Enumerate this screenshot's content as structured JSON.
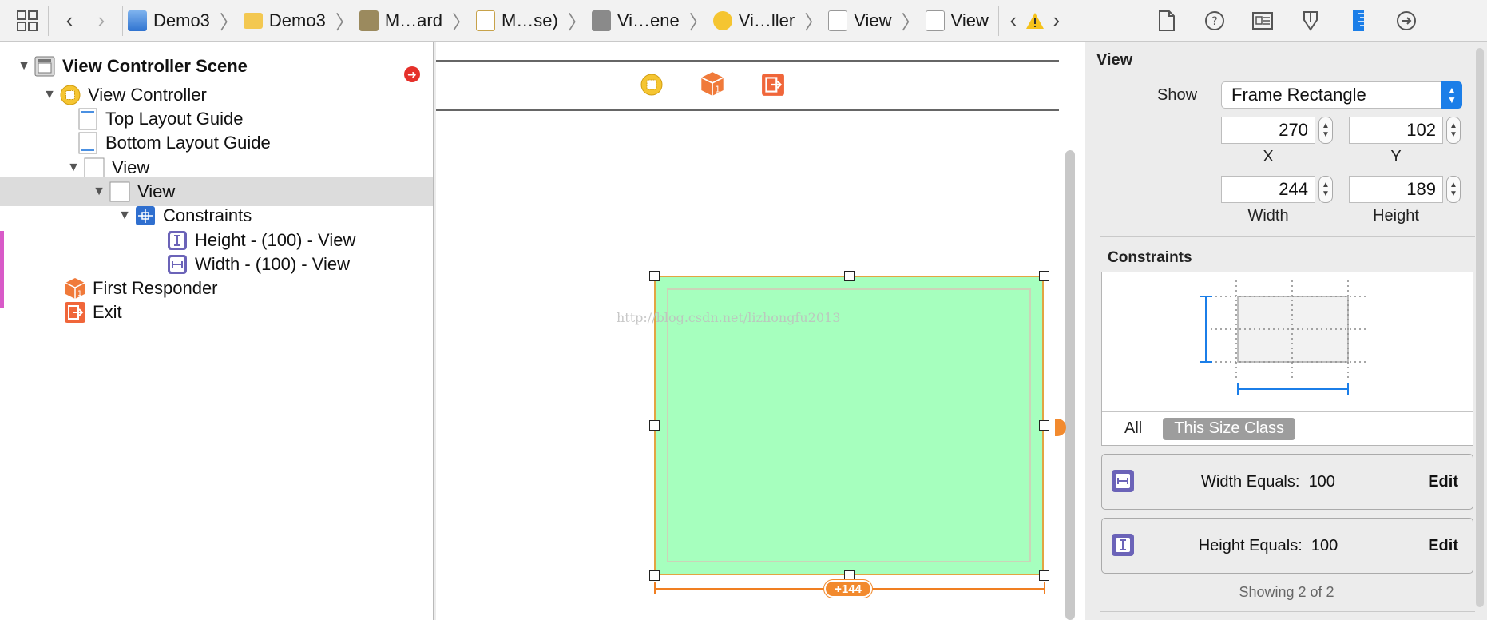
{
  "jumpbar": {
    "crumbs": [
      "Demo3",
      "Demo3",
      "M…ard",
      "M…se)",
      "Vi…ene",
      "Vi…ller",
      "View",
      "View"
    ]
  },
  "navigator": {
    "scene_title": "View Controller Scene",
    "items": [
      {
        "label": "View Controller"
      },
      {
        "label": "Top Layout Guide"
      },
      {
        "label": "Bottom Layout Guide"
      },
      {
        "label": "View"
      },
      {
        "label": "View"
      },
      {
        "label": "Constraints"
      },
      {
        "label": "Height - (100) - View"
      },
      {
        "label": "Width - (100) - View"
      },
      {
        "label": "First Responder"
      },
      {
        "label": "Exit"
      }
    ]
  },
  "canvas": {
    "watermark": "http://blog.csdn.net/lizhongfu2013",
    "distance_badge": "+144",
    "colors": {
      "view_fill": "#a6ffbe",
      "selection": "#e2a542",
      "guide": "#f07f22"
    }
  },
  "inspector": {
    "section_title": "View",
    "show_label": "Show",
    "show_value": "Frame Rectangle",
    "x_value": "270",
    "y_value": "102",
    "width_value": "244",
    "height_value": "189",
    "x_label": "X",
    "y_label": "Y",
    "width_label": "Width",
    "height_label": "Height",
    "constraints_title": "Constraints",
    "filter_all": "All",
    "filter_size_class": "This Size Class",
    "constraints": [
      {
        "label": "Width Equals:",
        "value": "100",
        "edit": "Edit"
      },
      {
        "label": "Height Equals:",
        "value": "100",
        "edit": "Edit"
      }
    ],
    "showing": "Showing 2 of 2",
    "accent": "#1b7ee8"
  }
}
